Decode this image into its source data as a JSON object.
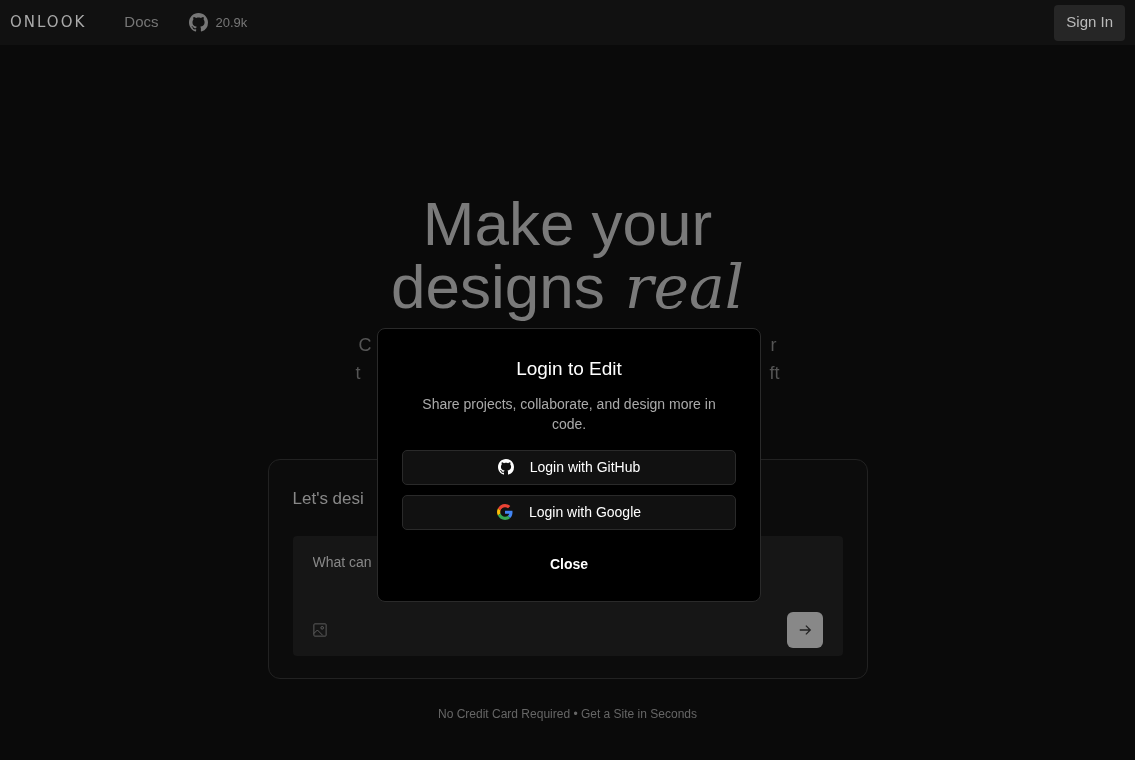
{
  "nav": {
    "logo": "ONLOOK",
    "links": [
      {
        "label": "Docs"
      }
    ],
    "github_stars": "20.9k",
    "sign_in": "Sign In"
  },
  "hero": {
    "title_line_1": "Make your",
    "title_line_2": "designs",
    "title_script": "real",
    "subtitle_fragments": [
      {
        "left": "C",
        "right": "r"
      },
      {
        "left": "t",
        "right": "ft"
      }
    ]
  },
  "prompt_card": {
    "title": "Let's desi",
    "placeholder": "What can"
  },
  "footer_note": "No Credit Card Required • Get a Site in Seconds",
  "dialog": {
    "title": "Login to Edit",
    "description": "Share projects, collaborate, and design more in code.",
    "buttons": [
      {
        "kind": "github",
        "label": "Login with GitHub"
      },
      {
        "kind": "google",
        "label": "Login with Google"
      }
    ],
    "close": "Close"
  }
}
